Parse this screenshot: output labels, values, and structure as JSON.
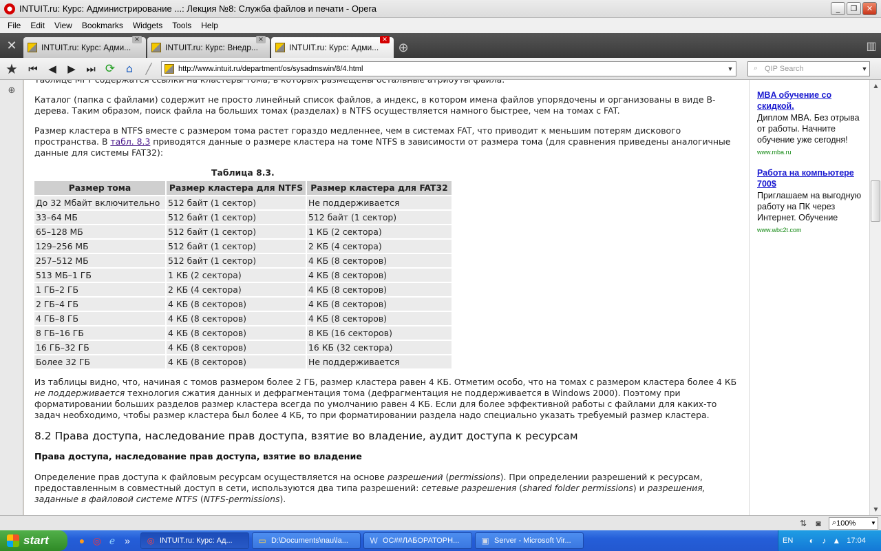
{
  "window": {
    "title": "INTUIT.ru: Курс: Администрирование ...: Лекция №8: Служба файлов и печати - Opera",
    "min": "_",
    "max": "❐",
    "close": "✕"
  },
  "menu": [
    "File",
    "Edit",
    "View",
    "Bookmarks",
    "Widgets",
    "Tools",
    "Help"
  ],
  "tabs": [
    {
      "label": "INTUIT.ru: Курс: Адми..."
    },
    {
      "label": "INTUIT.ru: Курс: Внедр..."
    },
    {
      "label": "INTUIT.ru: Курс: Адми..."
    }
  ],
  "address": {
    "url": "http://www.intuit.ru/department/os/sysadmswin/8/4.html",
    "search_placeholder": "QIP Search"
  },
  "article": {
    "p0": "Таблице MFT содержатся ссылки на кластеры тома, в которых размещены остальные атрибуты файла.",
    "p1": "Каталог (папка с файлами) содержит не просто линейный список файлов, а индекс, в котором имена файлов упорядочены и организованы в виде B-дерева. Таким образом, поиск файла на больших томах (разделах) в NTFS осуществляется намного быстрее, чем на томах с FAT.",
    "p2_a": "Размер кластера в NTFS вместе с размером тома растет гораздо медленнее, чем в системах FAT, что приводит к меньшим потерям дискового пространства. В ",
    "p2_link": "табл. 8.3",
    "p2_b": " приводятся данные о размере кластера на томе NTFS в зависимости от размера тома (для сравнения приведены аналогичные данные для системы FAT32):",
    "table_caption": "Таблица 8.3.",
    "table_headers": [
      "Размер тома",
      "Размер кластера для NTFS",
      "Размер кластера для FAT32"
    ],
    "table_rows": [
      [
        "До 32 Мбайт включительно",
        "512 байт (1 сектор)",
        "Не поддерживается"
      ],
      [
        "33–64 МБ",
        "512 байт (1 сектор)",
        "512 байт (1 сектор)"
      ],
      [
        "65–128 МБ",
        "512 байт (1 сектор)",
        "1 КБ (2 сектора)"
      ],
      [
        "129–256 МБ",
        "512 байт (1 сектор)",
        "2 КБ (4 сектора)"
      ],
      [
        "257–512 МБ",
        "512 байт (1 сектор)",
        "4 КБ (8 секторов)"
      ],
      [
        "513 МБ–1 ГБ",
        "1 КБ (2 сектора)",
        "4 КБ (8 секторов)"
      ],
      [
        "1 ГБ–2 ГБ",
        "2 КБ (4 сектора)",
        "4 КБ (8 секторов)"
      ],
      [
        "2 ГБ–4 ГБ",
        "4 КБ (8 секторов)",
        "4 КБ (8 секторов)"
      ],
      [
        "4 ГБ–8 ГБ",
        "4 КБ (8 секторов)",
        "4 КБ (8 секторов)"
      ],
      [
        "8 ГБ–16 ГБ",
        "4 КБ (8 секторов)",
        "8 КБ (16 секторов)"
      ],
      [
        "16 ГБ–32 ГБ",
        "4 КБ (8 секторов)",
        "16 КБ (32 сектора)"
      ],
      [
        "Более 32 ГБ",
        "4 КБ (8 секторов)",
        "Не поддерживается"
      ]
    ],
    "p3_a": "Из таблицы видно, что, начиная с томов размером более 2 ГБ, размер кластера равен 4 КБ. Отметим особо, что на томах с размером кластера более 4 КБ ",
    "p3_em": "не поддерживается",
    "p3_b": " технология сжатия данных и дефрагментация тома (дефрагментация не поддерживается в Windows 2000). Поэтому при форматировании больших разделов размер кластера всегда по умолчанию равен 4 КБ. Если для более эффективной работы с файлами для каких-то задач необходимо, чтобы размер кластера был более 4 КБ, то при форматировании раздела надо специально указать требуемый размер кластера.",
    "h2": "8.2 Права доступа, наследование прав доступа, взятие во владение, аудит доступа к ресурсам",
    "h3": "Права доступа, наследование прав доступа, взятие во владение",
    "p4_a": "Определение прав доступа к файловым ресурсам осуществляется на основе ",
    "p4_em1": "разрешений",
    "p4_b": " (",
    "p4_em2": "permissions",
    "p4_c": "). При определении разрешений к ресурсам, предоставленным в совместный доступ в сети, используются два типа разрешений: ",
    "p4_em3": "сетевые разрешения",
    "p4_d": " (",
    "p4_em4": "shared folder permissions",
    "p4_e": ") и ",
    "p4_em5": "разрешения, заданные в файловой системе NTFS",
    "p4_f": " (",
    "p4_em6": "NTFS-permissions",
    "p4_g": ")."
  },
  "ads": [
    {
      "title": "MBA обучение со скидкой.",
      "text": "Диплом MBA. Без отрыва от работы. Начните обучение уже сегодня!",
      "url": "www.mba.ru"
    },
    {
      "title": "Работа на компьютере 700$",
      "text": "Приглашаем на выгодную работу на ПК через Интернет. Обучение",
      "url": "www.wbc2t.com"
    }
  ],
  "status": {
    "zoom": "100%"
  },
  "taskbar": {
    "start": "start",
    "tasks": [
      {
        "label": "INTUIT.ru: Курс: Ад..."
      },
      {
        "label": "D:\\Documents\\nau\\la..."
      },
      {
        "label": "ОС##ЛАБОРАТОРН..."
      },
      {
        "label": "Server - Microsoft Vir..."
      }
    ],
    "lang": "EN",
    "time": "17:04"
  }
}
